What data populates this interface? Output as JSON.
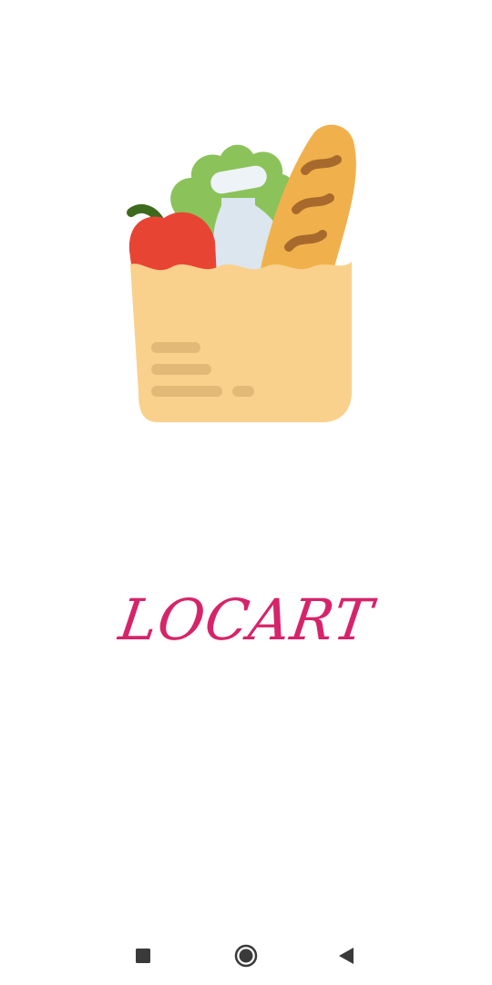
{
  "splash": {
    "app_name": "LOCART",
    "logo": "grocery-bag-icon",
    "brand_color": "#d6246a"
  },
  "nav_bar": {
    "recents": "square-icon",
    "home": "circle-icon",
    "back": "triangle-back-icon"
  }
}
